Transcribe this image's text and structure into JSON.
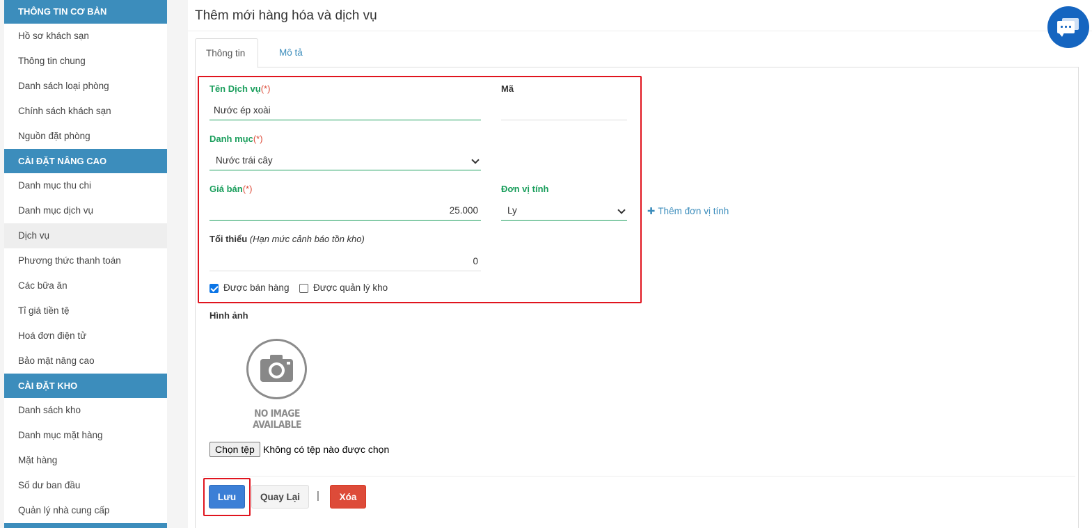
{
  "sidebar": {
    "sections": [
      {
        "title": "THÔNG TIN CƠ BẢN",
        "items": [
          "Hồ sơ khách sạn",
          "Thông tin chung",
          "Danh sách loại phòng",
          "Chính sách khách sạn",
          "Nguồn đặt phòng"
        ]
      },
      {
        "title": "CÀI ĐẶT NÂNG CAO",
        "items": [
          "Danh mục thu chi",
          "Danh mục dịch vụ",
          "Dịch vụ",
          "Phương thức thanh toán",
          "Các bữa ăn",
          "Tỉ giá tiền tệ",
          "Hoá đơn điện tử",
          "Bảo mật nâng cao"
        ]
      },
      {
        "title": "CÀI ĐẶT KHO",
        "items": [
          "Danh sách kho",
          "Danh mục mặt hàng",
          "Mặt hàng",
          "Số dư ban đầu",
          "Quản lý nhà cung cấp"
        ]
      }
    ],
    "active_item": "Dịch vụ"
  },
  "main": {
    "title": "Thêm mới hàng hóa và dịch vụ",
    "tabs": [
      "Thông tin",
      "Mô tả"
    ],
    "form": {
      "service_name_label": "Tên Dịch vụ",
      "required_mark": "(*)",
      "service_name_value": "Nước ép xoài",
      "code_label": "Mã",
      "code_value": "",
      "category_label": "Danh mục",
      "category_value": "Nước trái cây",
      "price_label": "Giá bán",
      "price_value": "25.000",
      "unit_label": "Đơn vị tính",
      "unit_value": "Ly",
      "add_unit_label": "Thêm đơn vị tính",
      "minimum_label": "Tối thiểu",
      "minimum_hint": "(Hạn mức cảnh báo tồn kho)",
      "minimum_value": "0",
      "can_sell_label": "Được bán hàng",
      "can_sell_checked": true,
      "stock_managed_label": "Được quản lý kho",
      "stock_managed_checked": false,
      "image_label": "Hình ảnh",
      "no_image_text": "NO IMAGE AVAILABLE",
      "choose_file_label": "Chọn tệp",
      "no_file_text": "Không có tệp nào được chọn"
    },
    "actions": {
      "save": "Lưu",
      "back": "Quay Lại",
      "separator": "|",
      "delete": "Xóa"
    }
  },
  "colors": {
    "sidebar_header": "#3c8dbc",
    "label_green": "#1a9e5c",
    "highlight_red": "#e0141e",
    "save_blue": "#3c7fd6",
    "delete_red": "#dd4b39",
    "chat_blue": "#1565c0"
  }
}
